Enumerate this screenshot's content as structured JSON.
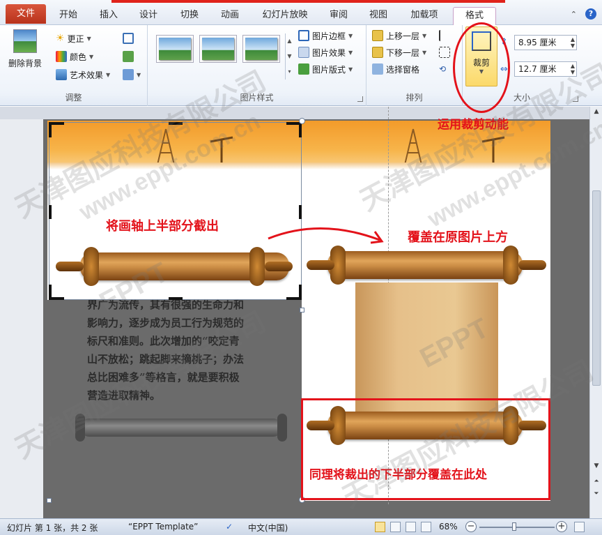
{
  "tabs": [
    "文件",
    "开始",
    "插入",
    "设计",
    "切换",
    "动画",
    "幻灯片放映",
    "审阅",
    "视图",
    "加载项",
    "格式"
  ],
  "ribbon": {
    "adjust": {
      "remove_bg": "删除背景",
      "corrections": "更正",
      "color": "颜色",
      "artistic": "艺术效果",
      "label": "调整"
    },
    "styles": {
      "border": "图片边框",
      "effects": "图片效果",
      "layout": "图片版式",
      "label": "图片样式"
    },
    "arrange": {
      "forward": "上移一层",
      "backward": "下移一层",
      "pane": "选择窗格",
      "label": "排列"
    },
    "size": {
      "crop": "裁剪",
      "width": "8.95 厘米",
      "height": "12.7 厘米",
      "label": "大小"
    }
  },
  "slide": {
    "dark_text": [
      "界广为流传，其有很强的生命力和",
      "影响力，逐步成为员工行为规范的",
      "标尺和准则。此次增加的“咬定青",
      "山不放松；跳起脚来摘桃子；办法",
      "总比困难多”等格言，就是要积极",
      "营造进取精神。"
    ]
  },
  "annotations": {
    "crop_feature": "运用裁剪动能",
    "cut_top": "将画轴上半部分截出",
    "cover_top": "覆盖在原图片上方",
    "cover_bottom": "同理将裁出的下半部分覆盖在此处"
  },
  "watermarks": [
    "天津图应科技有限公司",
    "www.eppt.com.cn",
    "EPPT"
  ],
  "status": {
    "slide_info": "幻灯片 第 1 张，共 2 张",
    "template": "“EPPT Template”",
    "language": "中文(中国)",
    "zoom": "68%"
  },
  "colors": {
    "accent_red": "#e3121a",
    "file_tab": "#c8412a"
  }
}
